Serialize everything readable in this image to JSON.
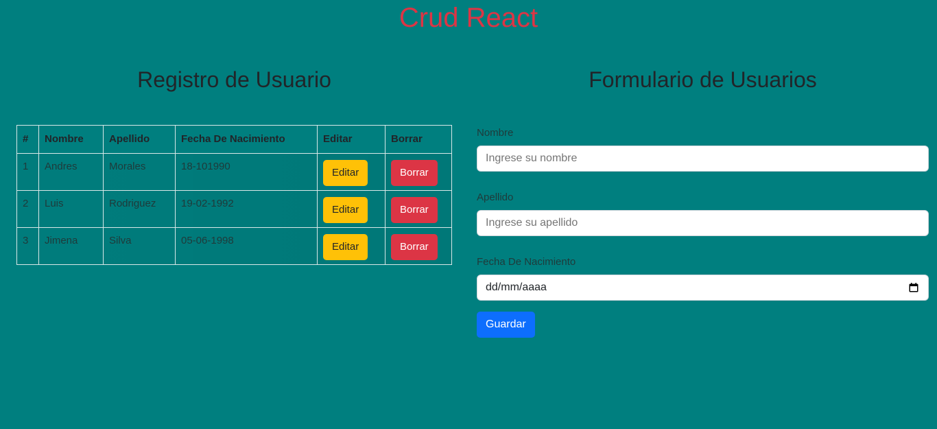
{
  "app": {
    "title": "Crud React"
  },
  "left": {
    "title": "Registro de Usuario",
    "table": {
      "headers": [
        "#",
        "Nombre",
        "Apellido",
        "Fecha De Nacimiento",
        "Editar",
        "Borrar"
      ],
      "rows": [
        {
          "id": "1",
          "nombre": "Andres",
          "apellido": "Morales",
          "fecha": "18-101990",
          "edit_label": "Editar",
          "delete_label": "Borrar"
        },
        {
          "id": "2",
          "nombre": "Luis",
          "apellido": "Rodriguez",
          "fecha": "19-02-1992",
          "edit_label": "Editar",
          "delete_label": "Borrar"
        },
        {
          "id": "3",
          "nombre": "Jimena",
          "apellido": "Silva",
          "fecha": "05-06-1998",
          "edit_label": "Editar",
          "delete_label": "Borrar"
        }
      ]
    }
  },
  "right": {
    "title": "Formulario de Usuarios",
    "form": {
      "nombre_label": "Nombre",
      "nombre_placeholder": "Ingrese su nombre",
      "apellido_label": "Apellido",
      "apellido_placeholder": "Ingrese su apellido",
      "fecha_label": "Fecha De Nacimiento",
      "fecha_value": "dd/mm/aaaa",
      "submit_label": "Guardar"
    }
  },
  "colors": {
    "background": "#007f7f",
    "title": "#dc3545",
    "edit_button": "#ffc107",
    "delete_button": "#dc3545",
    "submit_button": "#0d6efd"
  },
  "icons": {
    "date_picker": "calendar-icon"
  }
}
